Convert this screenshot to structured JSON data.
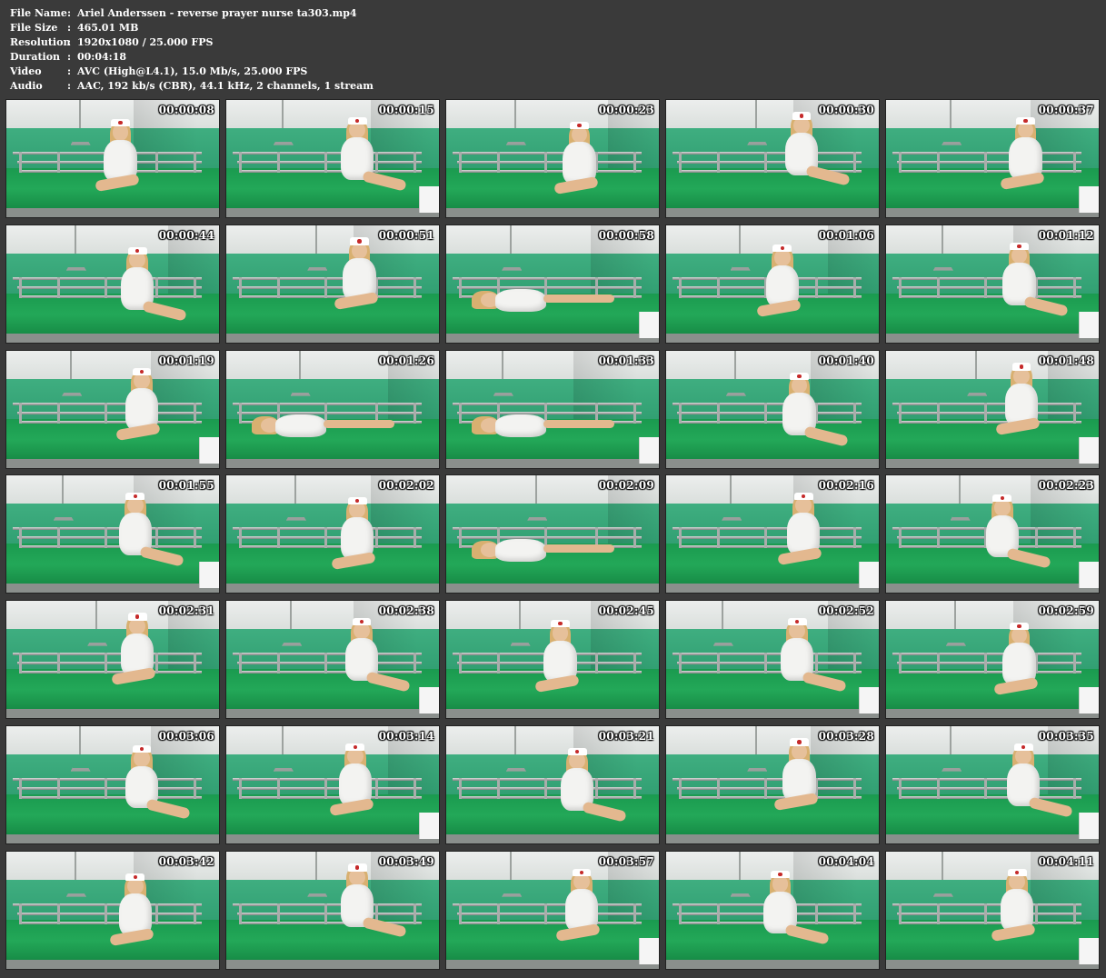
{
  "info": {
    "rows": [
      {
        "key": "File Name",
        "sep": ":",
        "value": "Ariel Anderssen - reverse prayer nurse ta303.mp4"
      },
      {
        "key": "File Size",
        "sep": ":",
        "value": "465.01 MB"
      },
      {
        "key": "Resolution",
        "sep": ":",
        "value": "1920x1080 / 25.000 FPS"
      },
      {
        "key": "Duration",
        "sep": ":",
        "value": "00:04:18"
      },
      {
        "key": "Video",
        "sep": ":",
        "value": "AVC (High@L4.1), 15.0 Mb/s, 25.000 FPS"
      },
      {
        "key": "Audio",
        "sep": ":",
        "value": "AAC, 192 kb/s (CBR), 44.1 kHz, 2 channels, 1 stream"
      }
    ]
  },
  "thumbnails": [
    "00:00:08",
    "00:00:15",
    "00:00:23",
    "00:00:30",
    "00:00:37",
    "00:00:44",
    "00:00:51",
    "00:00:58",
    "00:01:06",
    "00:01:12",
    "00:01:19",
    "00:01:26",
    "00:01:33",
    "00:01:40",
    "00:01:48",
    "00:01:55",
    "00:02:02",
    "00:02:09",
    "00:02:16",
    "00:02:23",
    "00:02:31",
    "00:02:38",
    "00:02:45",
    "00:02:52",
    "00:02:59",
    "00:03:06",
    "00:03:14",
    "00:03:21",
    "00:03:28",
    "00:03:35",
    "00:03:42",
    "00:03:49",
    "00:03:57",
    "00:04:04",
    "00:04:11"
  ],
  "colors": {
    "background": "#3a3a3a",
    "text": "#ffffff",
    "wall_green": "#33a174",
    "mattress_green": "#1a9a4f"
  }
}
